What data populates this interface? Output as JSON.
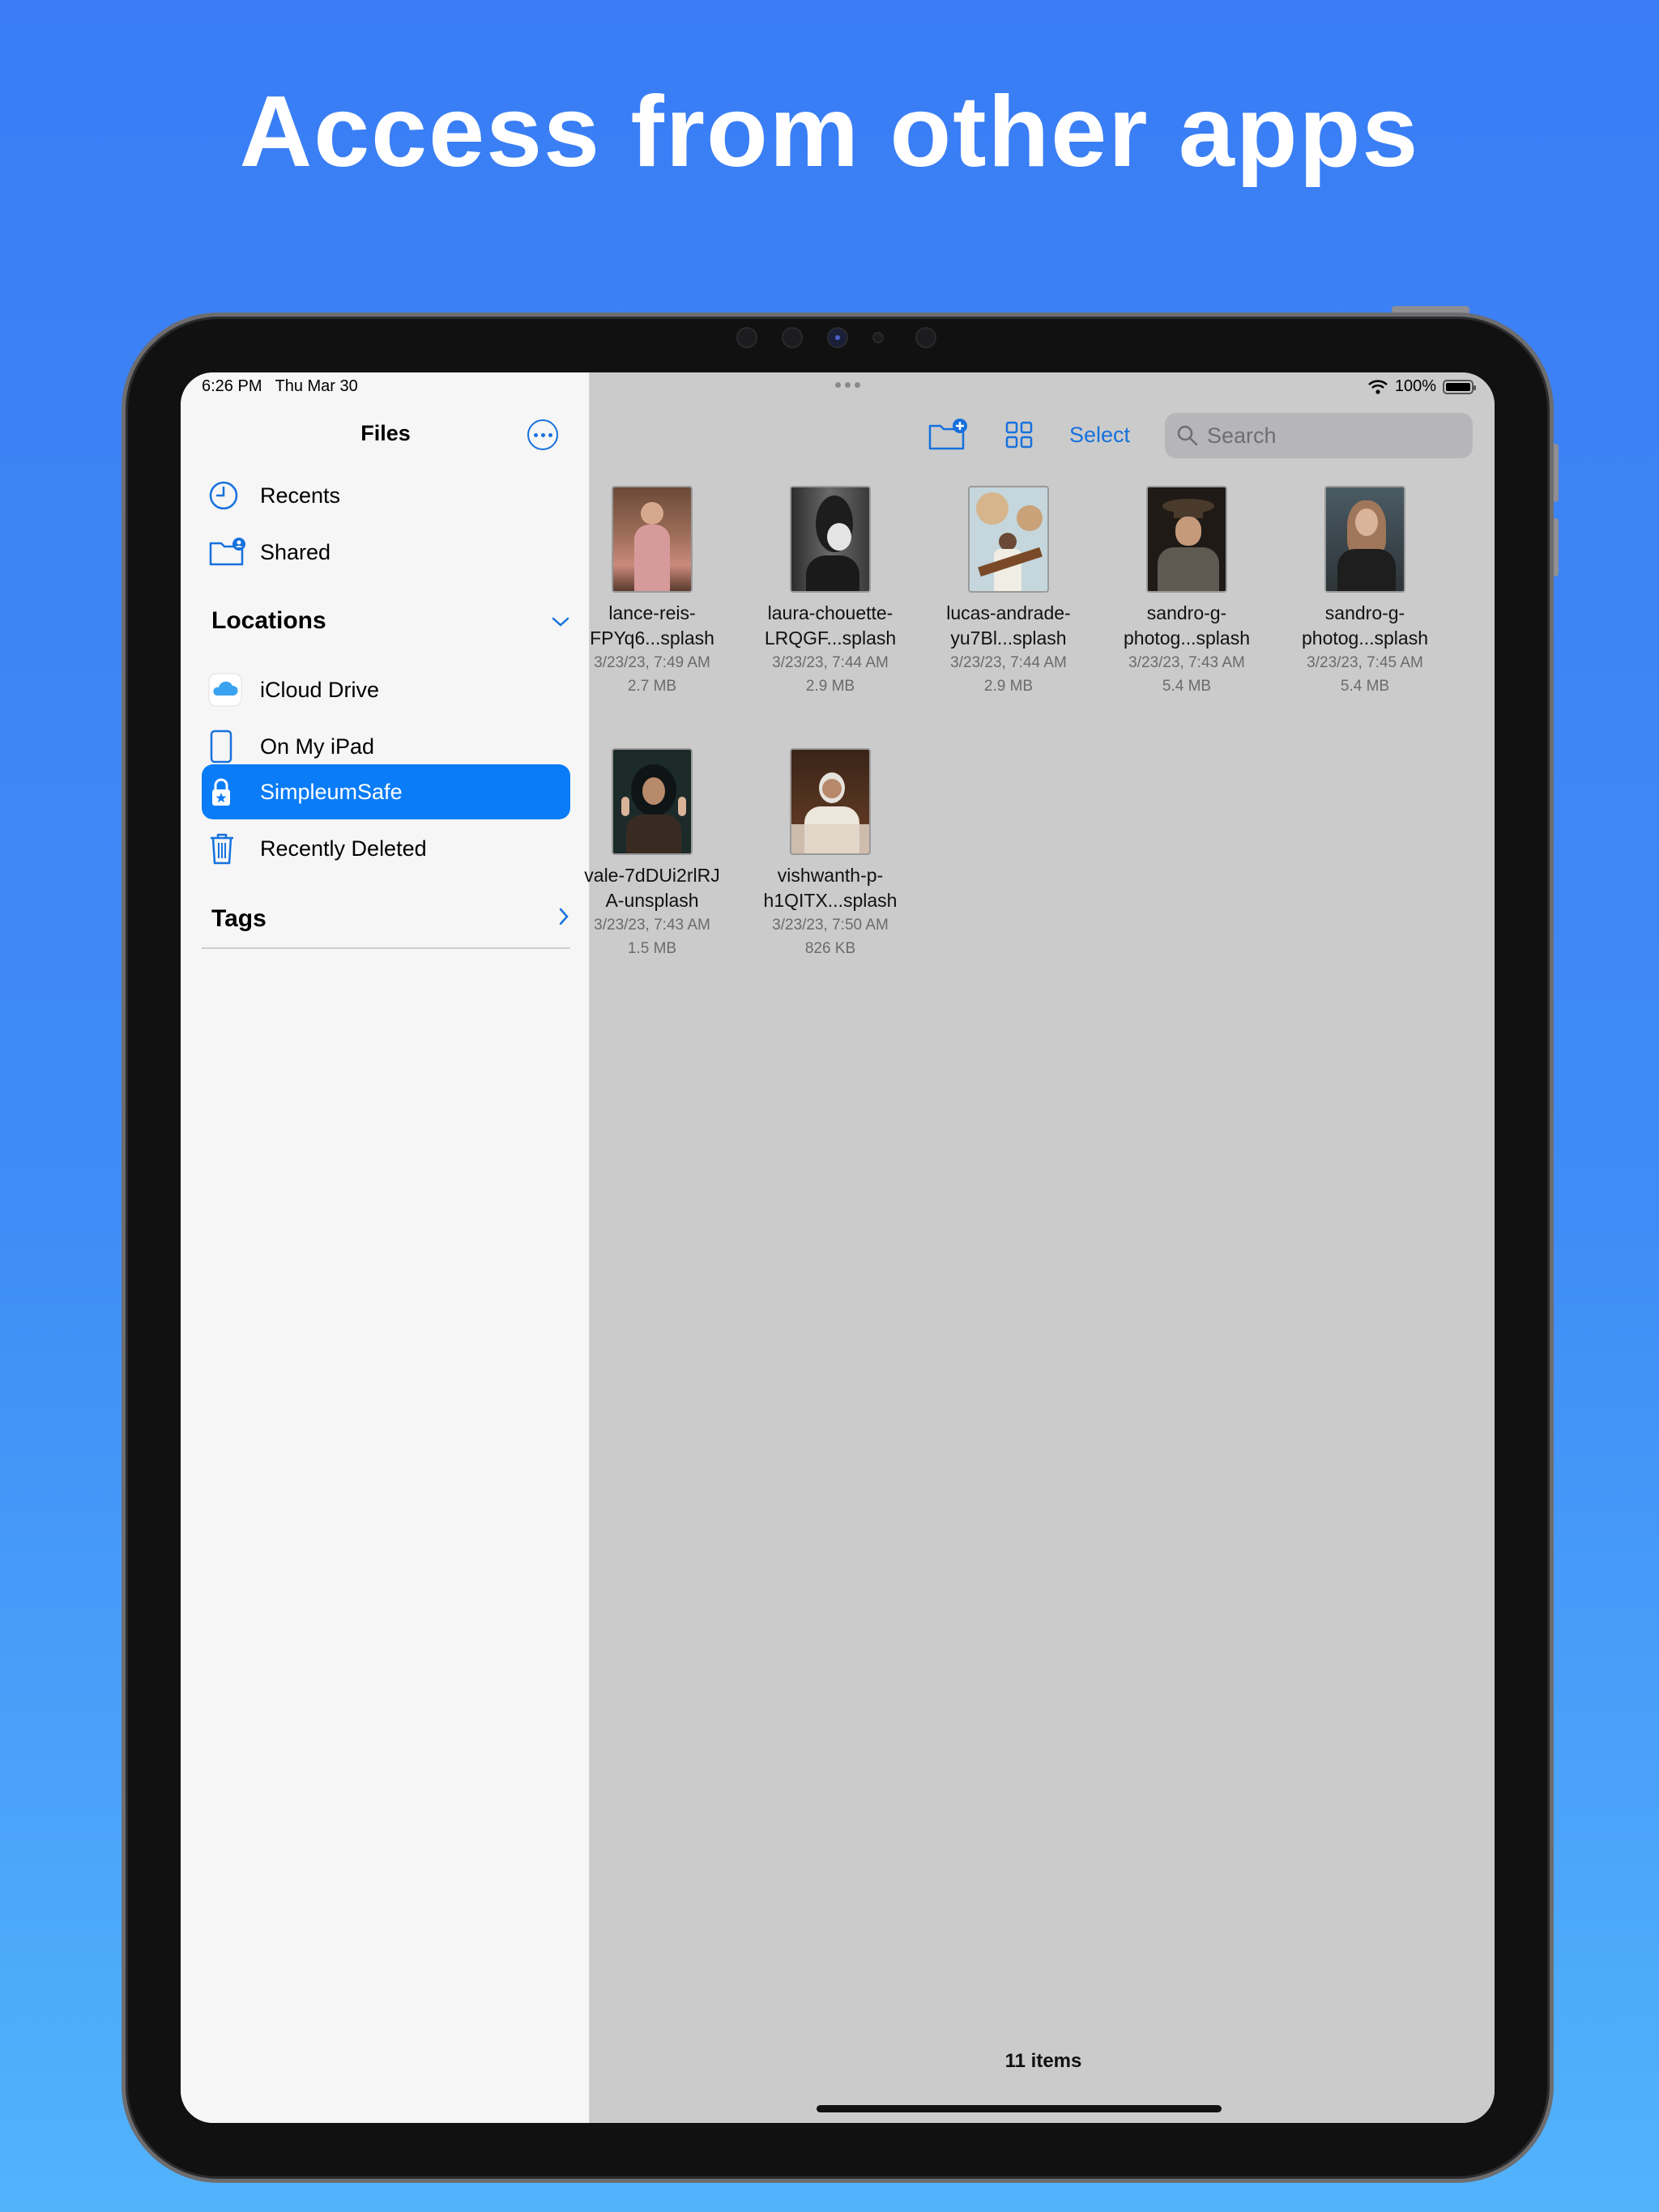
{
  "headline": "Access from other apps",
  "status": {
    "time": "6:26 PM",
    "date": "Thu Mar 30",
    "battery": "100%"
  },
  "sidebar": {
    "title": "Files",
    "favorites": [
      {
        "label": "Recents",
        "icon": "clock-icon"
      },
      {
        "label": "Shared",
        "icon": "shared-folder-icon"
      }
    ],
    "locations_header": "Locations",
    "locations": [
      {
        "label": "iCloud Drive",
        "icon": "icloud-icon"
      },
      {
        "label": "On My iPad",
        "icon": "ipad-icon"
      },
      {
        "label": "SimpleumSafe",
        "icon": "lock-icon",
        "active": true
      },
      {
        "label": "Recently Deleted",
        "icon": "trash-icon"
      }
    ],
    "tags_header": "Tags"
  },
  "toolbar": {
    "select_label": "Select",
    "search_placeholder": "Search"
  },
  "files": [
    {
      "name1": "lance-reis-",
      "name2": "FPYq6...splash",
      "date": "3/23/23, 7:49 AM",
      "size": "2.7 MB"
    },
    {
      "name1": "laura-chouette-",
      "name2": "LRQGF...splash",
      "date": "3/23/23, 7:44 AM",
      "size": "2.9 MB"
    },
    {
      "name1": "lucas-andrade-",
      "name2": "yu7Bl...splash",
      "date": "3/23/23, 7:44 AM",
      "size": "2.9 MB"
    },
    {
      "name1": "sandro-g-",
      "name2": "photog...splash",
      "date": "3/23/23, 7:43 AM",
      "size": "5.4 MB"
    },
    {
      "name1": "sandro-g-",
      "name2": "photog...splash",
      "date": "3/23/23, 7:45 AM",
      "size": "5.4 MB"
    },
    {
      "name1": "vale-7dDUi2rlRJ",
      "name2": "A-unsplash",
      "date": "3/23/23, 7:43 AM",
      "size": "1.5 MB"
    },
    {
      "name1": "vishwanth-p-",
      "name2": "h1QITX...splash",
      "date": "3/23/23, 7:50 AM",
      "size": "826 KB"
    }
  ],
  "footer": {
    "count": "11 items"
  },
  "colors": {
    "accent": "#1671dd",
    "selected": "#0a7cf7"
  }
}
